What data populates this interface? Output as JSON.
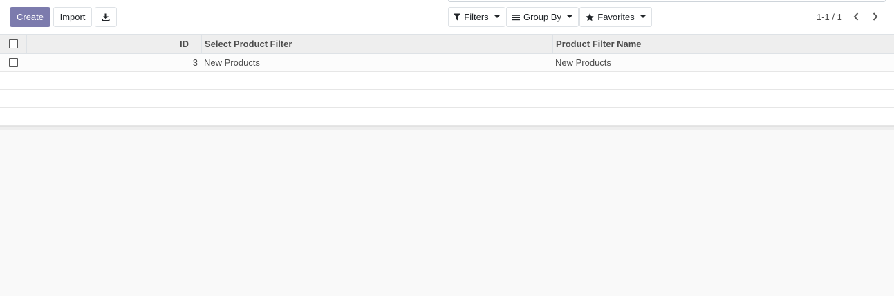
{
  "toolbar": {
    "create_label": "Create",
    "import_label": "Import",
    "download_icon": "download-icon"
  },
  "search": {
    "filters_label": "Filters",
    "groupby_label": "Group By",
    "favorites_label": "Favorites"
  },
  "pager": {
    "value": "1-1 / 1"
  },
  "table": {
    "columns": [
      "ID",
      "Select Product Filter",
      "Product Filter Name"
    ],
    "rows": [
      {
        "id": "3",
        "select_product_filter": "New Products",
        "product_filter_name": "New Products"
      }
    ]
  },
  "colors": {
    "primary": "#7c7bad",
    "header_bg": "#eeeeee",
    "page_bg": "#f9f9f9"
  }
}
